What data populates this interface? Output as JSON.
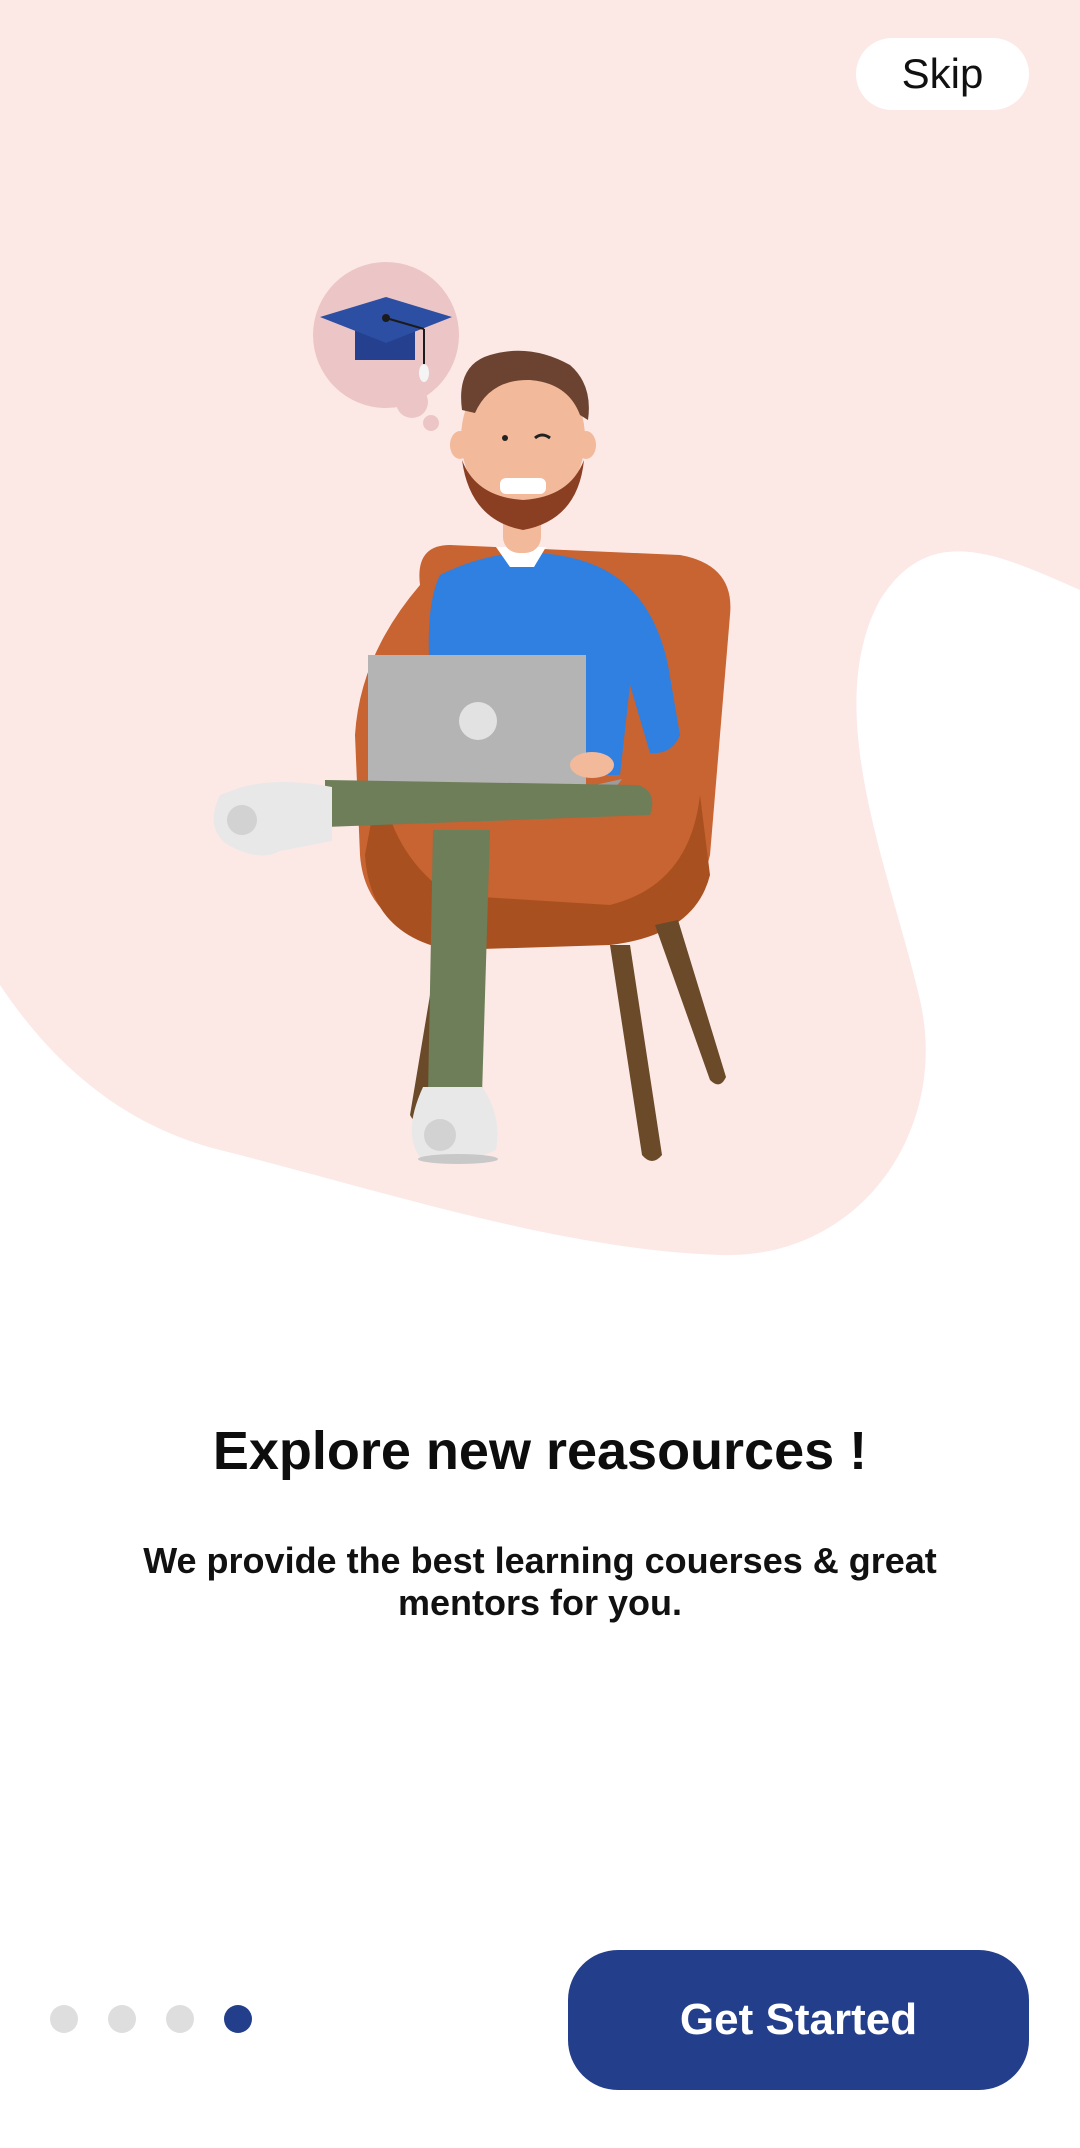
{
  "header": {
    "skip_label": "Skip"
  },
  "onboarding": {
    "headline": "Explore new reasources !",
    "subtext": "We provide the best  learning couerses & great mentors for you."
  },
  "pagination": {
    "total": 4,
    "current": 4
  },
  "footer": {
    "cta_label": "Get Started"
  },
  "illustration": {
    "subject": "man-with-laptop-on-armchair",
    "thought_bubble_icon": "graduation-cap-icon"
  },
  "colors": {
    "background_blob": "#fce9e6",
    "accent": "#233f8c",
    "dot_inactive": "#dedede",
    "dot_active": "#233f8c"
  }
}
